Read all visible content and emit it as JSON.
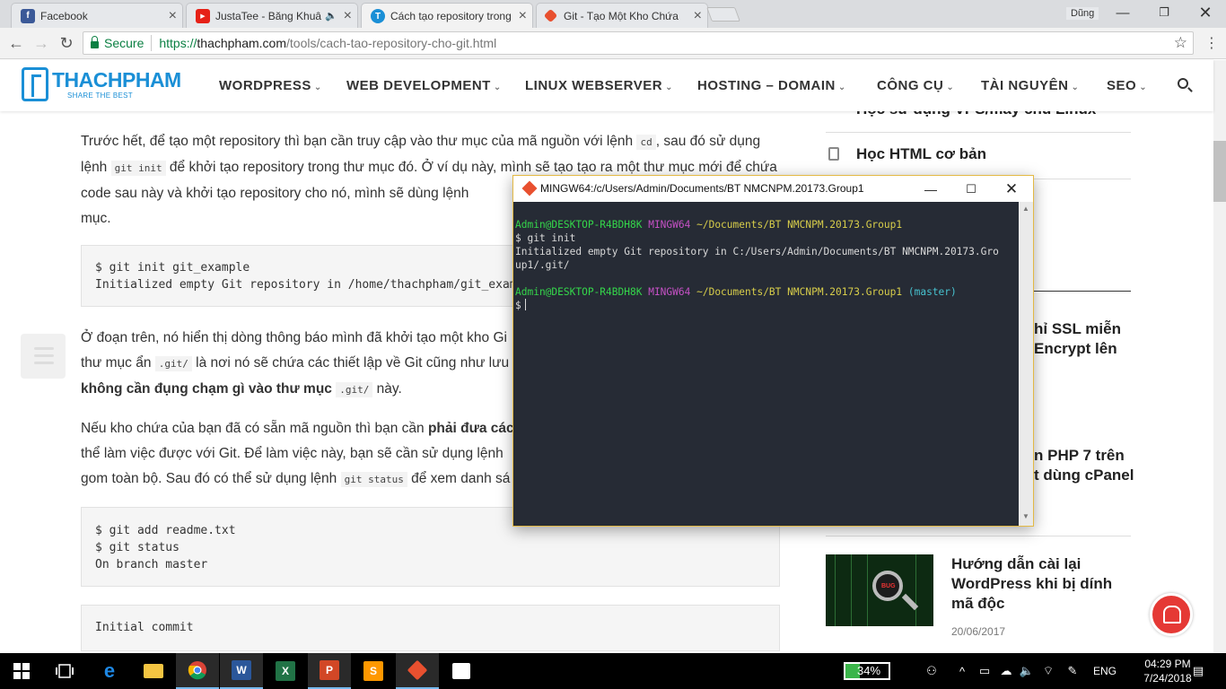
{
  "browser": {
    "tabs": [
      {
        "title": "Facebook",
        "favicon": "facebook-icon",
        "color": "#3b5998",
        "glyph": "f"
      },
      {
        "title": "JustaTee - Băng Khuâ",
        "favicon": "youtube-icon",
        "color": "#e62117",
        "glyph": "▶"
      },
      {
        "title": "Cách tạo repository trong",
        "favicon": "thachpham-icon",
        "color": "#1a8fd6",
        "glyph": "T"
      },
      {
        "title": "Git - Tạo Một Kho Chứa",
        "favicon": "git-icon",
        "color": "#e8502f",
        "glyph": "◆"
      }
    ],
    "profile_label": "Dũng",
    "secure_label": "Secure",
    "url_scheme": "https://",
    "url_host": "thachpham.com",
    "url_path": "/tools/cach-tao-repository-cho-git.html"
  },
  "site": {
    "logo_text": "THACHPHAM",
    "logo_tagline": "SHARE THE BEST",
    "menu": [
      "WORDPRESS",
      "WEB DEVELOPMENT",
      "LINUX WEBSERVER",
      "HOSTING – DOMAIN",
      "CÔNG CỤ",
      "TÀI NGUYÊN",
      "SEO"
    ]
  },
  "article": {
    "p1_a": "Trước hết, để tạo một repository thì bạn cần truy cập vào thư mục của mã nguồn với lệnh ",
    "p1_code1": "cd",
    "p1_b": ", sau đó sử dụng lệnh ",
    "p1_code2": "git init",
    "p1_c": " để khởi tạo repository trong thư mục đó. Ở ví dụ này, mình sẽ tạo tạo ra một thư mục mới để chứa code sau này và khởi tạo repository cho nó, mình sẽ dùng lệnh",
    "p1_d": "mục.",
    "code1": [
      "$ git init git_example",
      "Initialized empty Git repository in /home/thachpham/git_examp"
    ],
    "p2_a": "Ở đoạn trên, nó hiển thị dòng thông báo mình đã khởi tạo một kho Gi",
    "p2_b": "thư mục ẩn ",
    "p2_code1": ".git/",
    "p2_c": " là nơi nó sẽ chứa các thiết lập về Git cũng như lưu",
    "p2_bold": "không cần đụng chạm gì vào thư mục ",
    "p2_code2": ".git/",
    "p2_d": " này.",
    "p3_a": "Nếu kho chứa của bạn đã có sẵn mã nguồn thì bạn cần ",
    "p3_bold": "phải đưa các",
    "p3_b": "thể làm việc được với Git. Để làm việc này, bạn sẽ cần sử dụng lệnh",
    "p3_c": "gom toàn bộ. Sau đó có thể sử dụng lệnh ",
    "p3_code": "git status",
    "p3_d": " để xem danh sá",
    "code2": [
      "$ git add readme.txt",
      "$ git status",
      "On branch master"
    ],
    "code3": [
      "Initial commit"
    ]
  },
  "sidebar": {
    "item1": "Học sử dụng VPS/máy chủ Linux",
    "item2": "Học HTML cơ bản",
    "frag1_l1": "hỉ SSL miễn",
    "frag1_l2": "Encrypt lên",
    "frag2_l1": "n PHP 7 trên",
    "frag2_l2": "t dùng cPanel",
    "post_title_l1": "Hướng dẫn cài lại",
    "post_title_l2": "WordPress khi bị dính",
    "post_title_l3": "mã độc",
    "post_date": "20/06/2017",
    "thumb_text": "BUG"
  },
  "terminal": {
    "title": "MINGW64:/c/Users/Admin/Documents/BT NMCNPM.20173.Group1",
    "user_host": "Admin@DESKTOP-R4BDH8K",
    "env": "MINGW64",
    "path": "~/Documents/BT NMCNPM.20173.Group1",
    "branch": "(master)",
    "cmd1": "$ git init",
    "out1_l1": "Initialized empty Git repository in C:/Users/Admin/Documents/BT NMCNPM.20173.Gro",
    "out1_l2": "up1/.git/",
    "prompt2": "$"
  },
  "taskbar": {
    "apps": [
      "start-icon",
      "task-view-icon",
      "edge-icon",
      "file-explorer-icon",
      "chrome-icon",
      "word-icon",
      "excel-icon",
      "powerpoint-icon",
      "sublime-icon",
      "git-bash-icon",
      "store-icon"
    ],
    "battery_percent": "34%",
    "battery_level": 0.34,
    "language": "ENG",
    "time": "04:29 PM",
    "date": "7/24/2018"
  },
  "colors": {
    "accent": "#1a8fd6",
    "terminal_bg": "#262b35",
    "prompt_green": "#34d64a",
    "prompt_magenta": "#c551c5",
    "path_yellow": "#d7cd4a",
    "branch_cyan": "#47c2cf"
  }
}
